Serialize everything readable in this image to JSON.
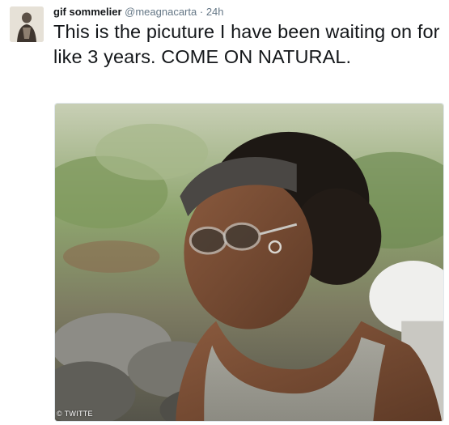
{
  "tweet": {
    "display_name": "gif sommelier",
    "handle": "@meagnacarta",
    "separator": "·",
    "timestamp": "24h",
    "text": "This is the picuture I have been waiting on for like 3 years. COME ON NATURAL."
  },
  "watermark": "© TWITTE",
  "colors": {
    "text_primary": "#14171a",
    "text_secondary": "#657786",
    "border": "#e1e8ed"
  }
}
